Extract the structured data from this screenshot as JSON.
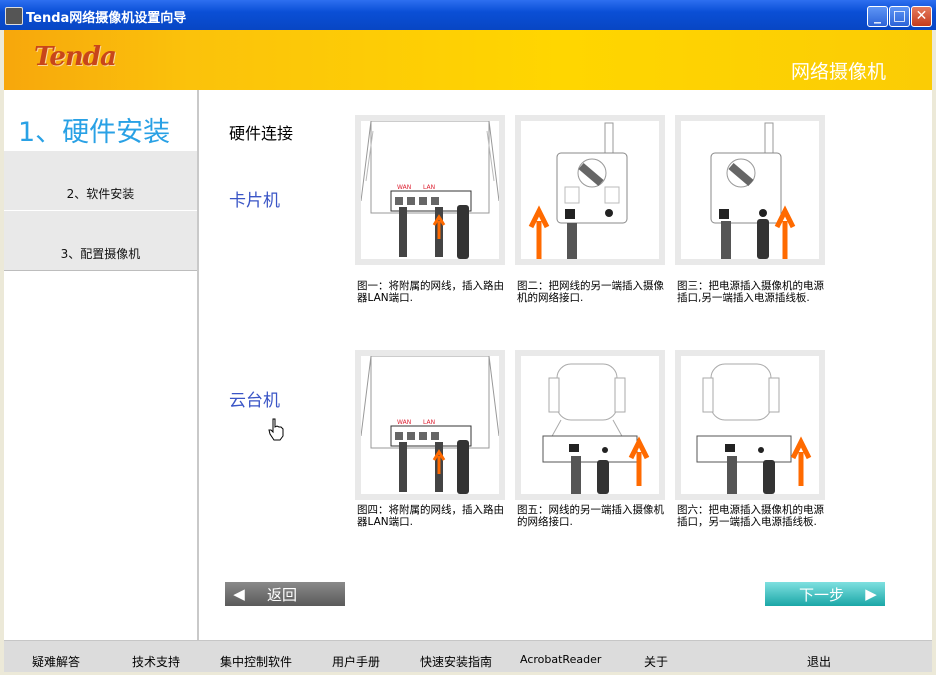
{
  "window": {
    "title": "Tenda网络摄像机设置向导"
  },
  "banner": {
    "logo": "Tenda",
    "product": "网络摄像机"
  },
  "sidebar": {
    "current_step": "1、硬件安装",
    "items": [
      {
        "label": "2、软件安装"
      },
      {
        "label": "3、配置摄像机"
      }
    ]
  },
  "main": {
    "section_title": "硬件连接",
    "groups": [
      {
        "name": "卡片机",
        "steps": [
          {
            "caption": "图一：将附属的网线，插入路由器LAN端口.",
            "labels": [
              "WAN",
              "LAN"
            ]
          },
          {
            "caption": "图二：把网线的另一端插入摄像机的网络接口."
          },
          {
            "caption": "图三：把电源插入摄像机的电源插口,另一端插入电源插线板."
          }
        ]
      },
      {
        "name": "云台机",
        "steps": [
          {
            "caption": "图四：将附属的网线，插入路由器LAN端口.",
            "labels": [
              "WAN",
              "LAN"
            ]
          },
          {
            "caption": "图五：网线的另一端插入摄像机的网络接口."
          },
          {
            "caption": "图六：把电源插入摄像机的电源插口，另一端插入电源插线板."
          }
        ]
      }
    ],
    "back_button": "返回",
    "next_button": "下一步"
  },
  "footer": {
    "items": [
      "疑难解答",
      "技术支持",
      "集中控制软件",
      "用户手册",
      "快速安装指南",
      "AcrobatReader",
      "关于",
      "退出"
    ]
  },
  "colors": {
    "accent_blue": "#29a1e5",
    "banner_orange": "#f7a70c",
    "arrow_orange": "#ff6a00",
    "category_blue": "#3a55c6"
  }
}
